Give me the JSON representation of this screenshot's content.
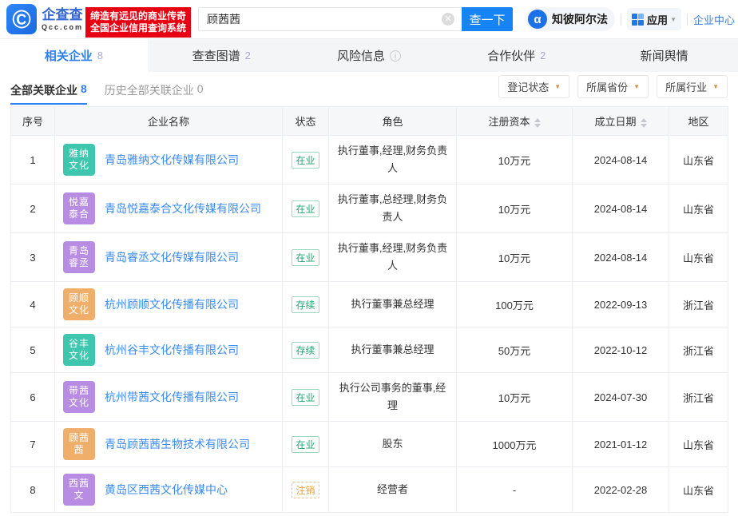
{
  "brand": {
    "name": "企查查",
    "domain": "Qcc.com",
    "slogan_line1": "缔造有远见的商业传奇",
    "slogan_line2": "全国企业信用查询系统",
    "logo_glyph": "©"
  },
  "search": {
    "value": "顾茜茜",
    "button_label": "查一下",
    "clear_glyph": "✕"
  },
  "header_actions": {
    "zhibi_label": "知彼阿尔法",
    "zhibi_icon_glyph": "α",
    "apps_label": "应用",
    "center_label": "企业中心"
  },
  "tabs": [
    {
      "label": "相关企业",
      "count": "8",
      "active": true
    },
    {
      "label": "查查图谱",
      "count": "2",
      "active": false
    },
    {
      "label": "风险信息",
      "count": "",
      "active": false,
      "info": true
    },
    {
      "label": "合作伙伴",
      "count": "2",
      "active": false
    },
    {
      "label": "新闻舆情",
      "count": "",
      "active": false
    }
  ],
  "subtabs": [
    {
      "label": "全部关联企业",
      "count": "8",
      "active": true
    },
    {
      "label": "历史全部关联企业",
      "count": "0",
      "active": false
    }
  ],
  "filters": [
    "登记状态",
    "所属省份",
    "所属行业"
  ],
  "table": {
    "headers": [
      {
        "label": "序号",
        "sortable": false
      },
      {
        "label": "企业名称",
        "sortable": false
      },
      {
        "label": "状态",
        "sortable": false
      },
      {
        "label": "角色",
        "sortable": false
      },
      {
        "label": "注册资本",
        "sortable": true
      },
      {
        "label": "成立日期",
        "sortable": true
      },
      {
        "label": "地区",
        "sortable": false
      }
    ],
    "rows": [
      {
        "no": "1",
        "logo_lines": [
          "雅纳",
          "文化"
        ],
        "logo_color": "#3ec6ae",
        "name": "青岛雅纳文化传媒有限公司",
        "status": "在业",
        "status_type": "green",
        "role": "执行董事,经理,财务负责\n人",
        "capital": "10万元",
        "date": "2024-08-14",
        "region": "山东省"
      },
      {
        "no": "2",
        "logo_lines": [
          "悦嘉",
          "泰合"
        ],
        "logo_color": "#b78ce2",
        "name": "青岛悦嘉泰合文化传媒有限公司",
        "status": "在业",
        "status_type": "green",
        "role": "执行董事,总经理,财务负\n责人",
        "capital": "10万元",
        "date": "2024-08-14",
        "region": "山东省"
      },
      {
        "no": "3",
        "logo_lines": [
          "青岛",
          "睿丞"
        ],
        "logo_color": "#b78ce2",
        "name": "青岛睿丞文化传媒有限公司",
        "status": "在业",
        "status_type": "green",
        "role": "执行董事,经理,财务负责\n人",
        "capital": "10万元",
        "date": "2024-08-14",
        "region": "山东省"
      },
      {
        "no": "4",
        "logo_lines": [
          "顾顺",
          "文化"
        ],
        "logo_color": "#efaf6b",
        "name": "杭州顾顺文化传播有限公司",
        "status": "存续",
        "status_type": "green",
        "role": "执行董事兼总经理",
        "capital": "100万元",
        "date": "2022-09-13",
        "region": "浙江省"
      },
      {
        "no": "5",
        "logo_lines": [
          "谷丰",
          "文化"
        ],
        "logo_color": "#3ec6ae",
        "name": "杭州谷丰文化传播有限公司",
        "status": "存续",
        "status_type": "green",
        "role": "执行董事兼总经理",
        "capital": "50万元",
        "date": "2022-10-12",
        "region": "浙江省"
      },
      {
        "no": "6",
        "logo_lines": [
          "带茜",
          "文化"
        ],
        "logo_color": "#b78ce2",
        "name": "杭州带茜文化传播有限公司",
        "status": "在业",
        "status_type": "green",
        "role": "执行公司事务的董事,经\n理",
        "capital": "10万元",
        "date": "2024-07-30",
        "region": "浙江省"
      },
      {
        "no": "7",
        "logo_lines": [
          "顾茜",
          "茜"
        ],
        "logo_color": "#efaf6b",
        "name": "青岛顾茜茜生物技术有限公司",
        "status": "在业",
        "status_type": "green",
        "role": "股东",
        "capital": "1000万元",
        "date": "2021-01-12",
        "region": "山东省"
      },
      {
        "no": "8",
        "logo_lines": [
          "西茜",
          "文"
        ],
        "logo_color": "#b78ce2",
        "name": "黄岛区西茜文化传媒中心",
        "status": "注销",
        "status_type": "orange",
        "role": "经营者",
        "capital": "-",
        "date": "2022-02-28",
        "region": "山东省"
      }
    ]
  }
}
